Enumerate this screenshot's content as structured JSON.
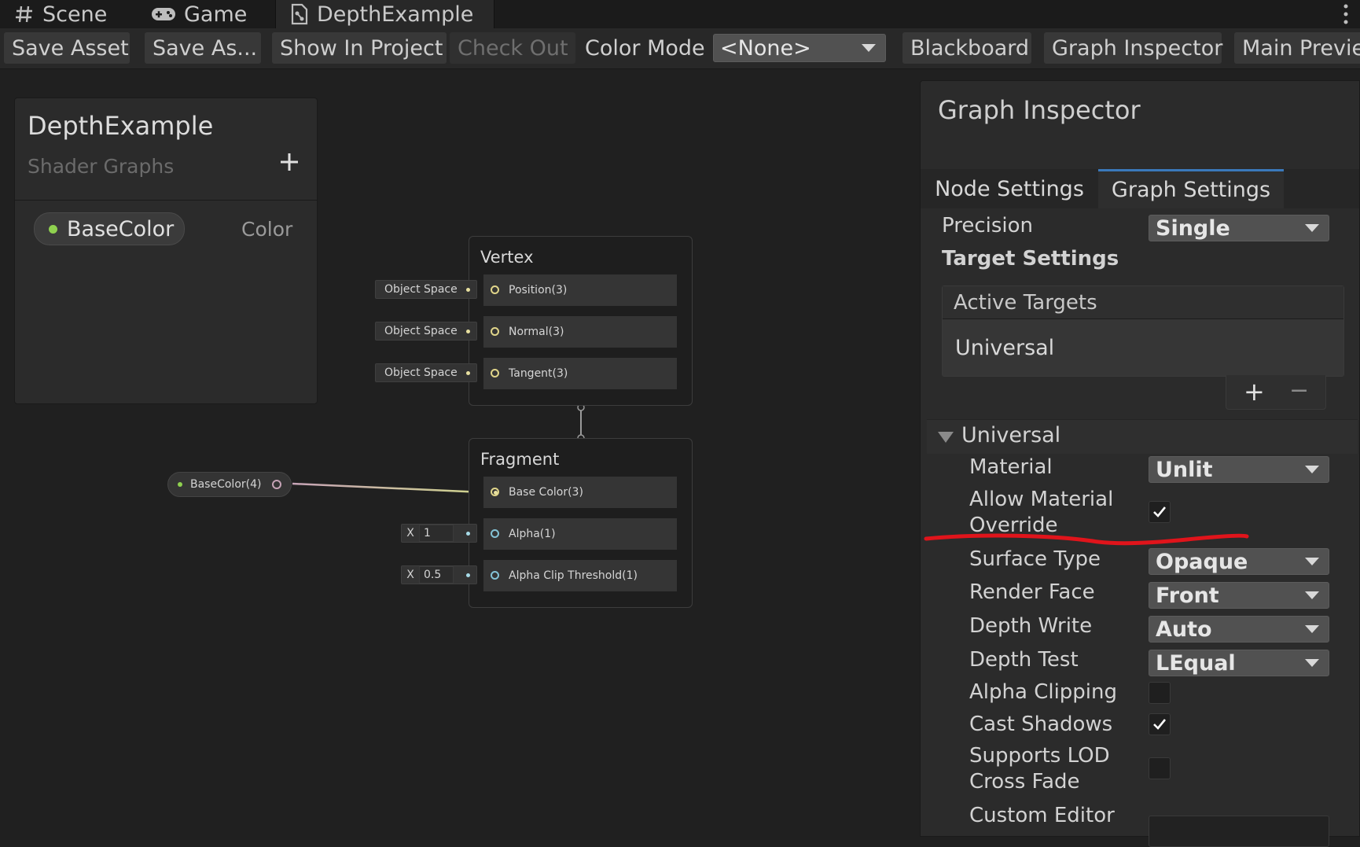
{
  "window_tabs": [
    {
      "label": "Scene",
      "icon": "hash-icon"
    },
    {
      "label": "Game",
      "icon": "gamepad-icon"
    },
    {
      "label": "DepthExample",
      "icon": "shader-graph-icon"
    }
  ],
  "toolbar": {
    "save_asset": "Save Asset",
    "save_as": "Save As...",
    "show_in_project": "Show In Project",
    "check_out": "Check Out",
    "color_mode_label": "Color Mode",
    "color_mode_value": "<None>",
    "blackboard": "Blackboard",
    "graph_inspector": "Graph Inspector",
    "main_preview": "Main Previe"
  },
  "blackboard": {
    "title": "DepthExample",
    "subtitle": "Shader Graphs",
    "property_name": "BaseColor",
    "property_type": "Color",
    "property_color": "#8fd14f"
  },
  "vertex_node": {
    "title": "Vertex",
    "slots": [
      {
        "label": "Position(3)",
        "input": "Object Space"
      },
      {
        "label": "Normal(3)",
        "input": "Object Space"
      },
      {
        "label": "Tangent(3)",
        "input": "Object Space"
      }
    ]
  },
  "fragment_node": {
    "title": "Fragment",
    "slots": [
      {
        "label": "Base Color(3)"
      },
      {
        "label": "Alpha(1)",
        "axis": "X",
        "value": "1"
      },
      {
        "label": "Alpha Clip Threshold(1)",
        "axis": "X",
        "value": "0.5"
      }
    ]
  },
  "property_node": {
    "label": "BaseColor(4)"
  },
  "inspector": {
    "title": "Graph Inspector",
    "tabs": [
      "Node Settings",
      "Graph Settings"
    ],
    "active_tab": "Graph Settings",
    "precision_label": "Precision",
    "precision_value": "Single",
    "target_settings": "Target Settings",
    "active_targets": "Active Targets",
    "target_item": "Universal",
    "add_symbol": "+",
    "remove_symbol": "−",
    "section": "Universal",
    "material_label": "Material",
    "material_value": "Unlit",
    "allow_override_label_1": "Allow Material",
    "allow_override_label_2": "Override",
    "allow_override_checked": true,
    "surface_type_label": "Surface Type",
    "surface_type_value": "Opaque",
    "render_face_label": "Render Face",
    "render_face_value": "Front",
    "depth_write_label": "Depth Write",
    "depth_write_value": "Auto",
    "depth_test_label": "Depth Test",
    "depth_test_value": "LEqual",
    "alpha_clipping_label": "Alpha Clipping",
    "alpha_clipping_checked": false,
    "cast_shadows_label": "Cast Shadows",
    "cast_shadows_checked": true,
    "lod_label_1": "Supports LOD",
    "lod_label_2": "Cross Fade",
    "lod_checked": false,
    "custom_editor_label": "Custom Editor"
  },
  "colors": {
    "accent_tab_underline": "#3a79bb",
    "annotation_red": "#e0141b",
    "float_edge": "#84c3d6",
    "vector_edge": "#d6d59a"
  }
}
